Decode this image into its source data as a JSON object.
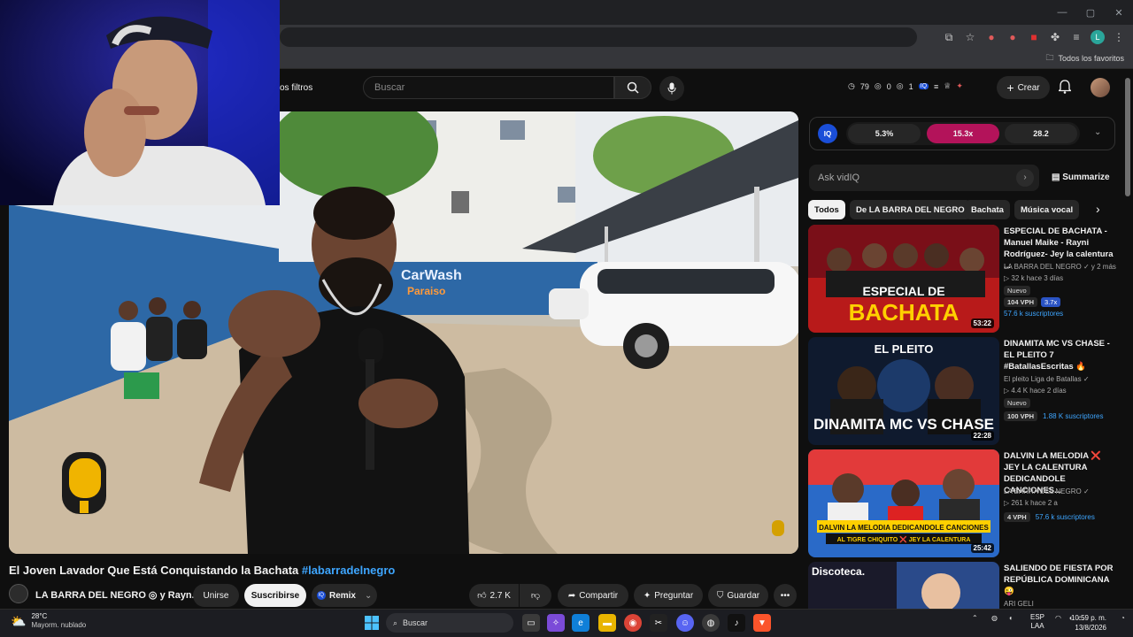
{
  "browser": {
    "favorites_label": "Todos los favoritos",
    "profile_initial": "L"
  },
  "header": {
    "filters_label": "os filtros",
    "search_placeholder": "Buscar",
    "stats": {
      "watch": "79",
      "views": "0",
      "eye": "1"
    },
    "create_label": "Crear"
  },
  "video": {
    "title_main": "El Joven Lavador Que Está Conquistando la Bachata ",
    "title_hashtag": "#labarradelnegro",
    "channel_name": "LA BARRA DEL NEGRO ◎ y Rayn...",
    "join_label": "Unirse",
    "subscribe_label": "Suscribirse",
    "remix_label": "Remix",
    "likes": "2.7 K",
    "share_label": "Compartir",
    "ask_label": "Preguntar",
    "save_label": "Guardar",
    "sign_text_1": "CarWash",
    "sign_text_2": "Paraiso"
  },
  "vidiq": {
    "logo": "IQ",
    "metric_1": "5.3%",
    "metric_2": "15.3x",
    "metric_3": "28.2",
    "ask_placeholder": "Ask vidIQ",
    "summarize_label": "Summarize"
  },
  "chips": [
    "Todos",
    "De LA BARRA DEL NEGRO",
    "Bachata",
    "Música vocal"
  ],
  "recommendations": [
    {
      "title": "ESPECIAL DE BACHATA - Manuel Maike - Rayni Rodríguez- Jey la calentura ...",
      "channel": "LA BARRA DEL NEGRO ✓ y 2 más",
      "stats": "▷ 32 k  hace 3 días",
      "badge": "Nuevo",
      "vph": "104 VPH",
      "multiplier": "3.7x",
      "subs": "57.6 k suscriptores",
      "duration": "53:22",
      "thumb_text_1": "ESPECIAL DE",
      "thumb_text_2": "BACHATA"
    },
    {
      "title": "DINAMITA MC VS CHASE - EL PLEITO 7 #BatallasEscritas 🔥",
      "channel": "El pleito Liga de Batallas ✓",
      "stats": "▷ 4.4 K  hace 2 días",
      "badge": "Nuevo",
      "vph": "100 VPH",
      "subs": "1.88 K suscriptores",
      "duration": "22:28",
      "thumb_text_1": "EL PLEITO",
      "thumb_text_2": "DINAMITA MC VS CHASE"
    },
    {
      "title": "DALVIN LA MELODIA ❌ JEY LA CALENTURA DEDICANDOLE CANCIONES...",
      "channel": "LA BARRA DEL NEGRO ✓",
      "stats": "▷ 261 k  hace 2 a",
      "vph": "4 VPH",
      "subs": "57.6 k suscriptores",
      "duration": "25:42",
      "thumb_text_1": "DALVIN LA MELODIA DEDICANDOLE CANCIONES",
      "thumb_text_2": "AL TIGRE CHIQUITO ❌ JEY LA CALENTURA"
    },
    {
      "title": "SALIENDO DE FIESTA POR REPÚBLICA DOMINICANA😜",
      "channel": "ARI GELI",
      "thumb_text_1": "Discoteca."
    }
  ],
  "taskbar": {
    "temp": "28°C",
    "weather": "Mayorm. nublado",
    "search": "Buscar",
    "lang_1": "ESP",
    "lang_2": "LAA",
    "time": "10:59 p. m.",
    "date": "13/8/2026"
  },
  "colors": {
    "accent_blue": "#3ea6ff",
    "vidiq_hot": "#b3135a",
    "vidiq_blue": "#1a4ed8"
  }
}
